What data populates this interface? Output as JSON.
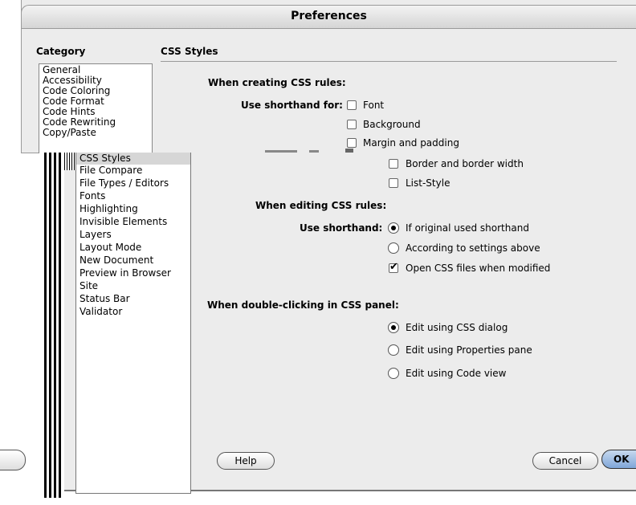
{
  "window": {
    "title": "Preferences"
  },
  "category_header": "Category",
  "section_header": "CSS Styles",
  "categories_top": [
    "General",
    "Accessibility",
    "Code Coloring",
    "Code Format",
    "Code Hints",
    "Code Rewriting",
    "Copy/Paste"
  ],
  "categories_bottom": [
    "CSS Styles",
    "File Compare",
    "File Types / Editors",
    "Fonts",
    "Highlighting",
    "Invisible Elements",
    "Layers",
    "Layout Mode",
    "New Document",
    "Preview in Browser",
    "Site",
    "Status Bar",
    "Validator"
  ],
  "creating": {
    "heading": "When creating CSS rules:",
    "shorthand_label": "Use shorthand for:",
    "options": [
      {
        "label": "Font",
        "checked": false
      },
      {
        "label": "Background",
        "checked": false
      },
      {
        "label": "Margin and padding",
        "checked": false
      },
      {
        "label": "Border and border width",
        "checked": false
      },
      {
        "label": "List-Style",
        "checked": false
      }
    ]
  },
  "editing": {
    "heading": "When editing CSS rules:",
    "shorthand_label": "Use shorthand:",
    "radio_if_original": "If original used shorthand",
    "radio_according": "According to settings above",
    "open_css_label": "Open CSS files when modified",
    "open_css_checked": true,
    "selected": "if_original"
  },
  "double_click": {
    "heading": "When double-clicking in CSS panel:",
    "options": [
      "Edit using CSS dialog",
      "Edit using Properties pane",
      "Edit using Code view"
    ],
    "selected_index": 0
  },
  "buttons": {
    "help": "Help",
    "cancel": "Cancel",
    "ok": "OK"
  },
  "colors": {
    "window_bg": "#ececec",
    "selection": "#d6d6d6",
    "ok_blue": "#7fa6d8"
  }
}
